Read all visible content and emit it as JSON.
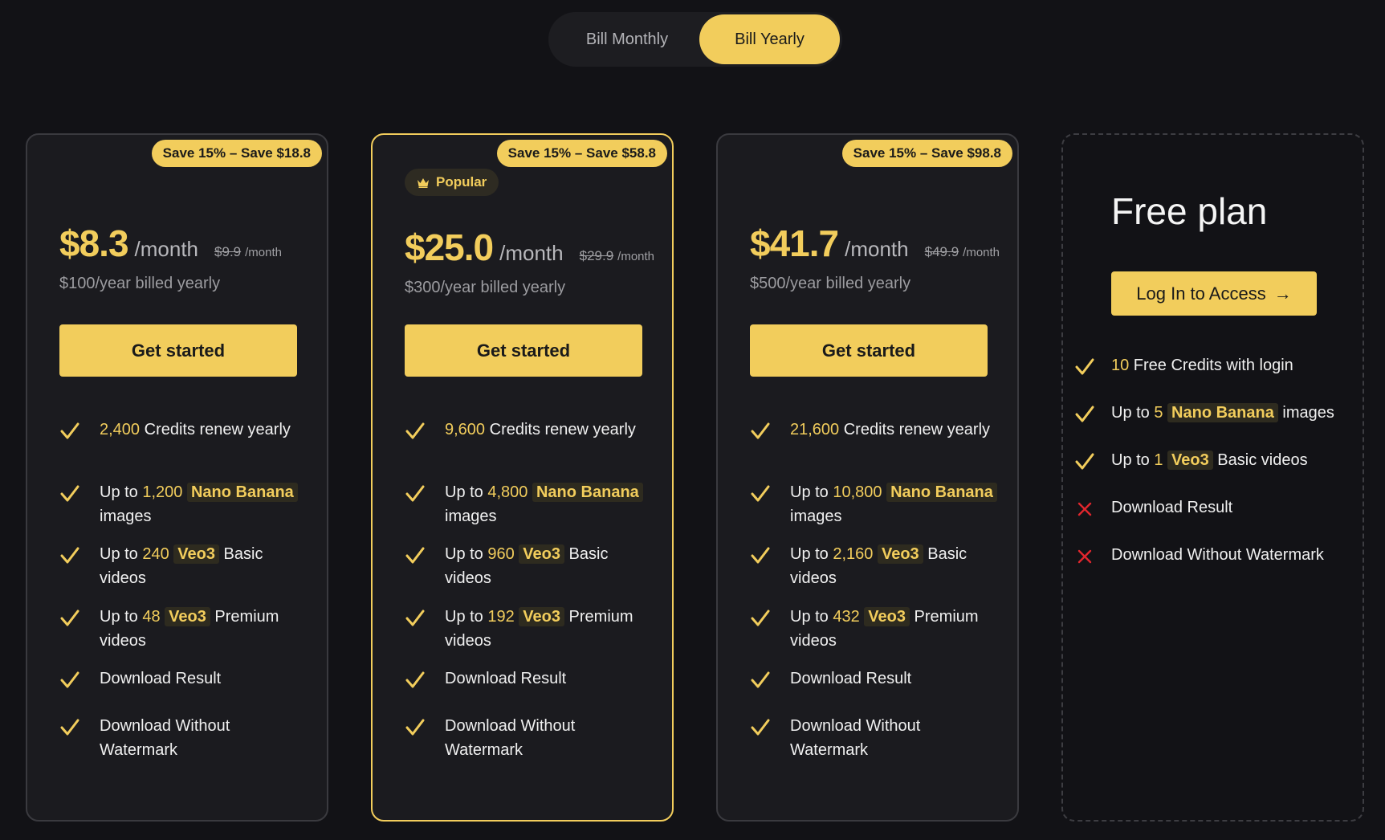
{
  "billing_toggle": {
    "monthly_label": "Bill Monthly",
    "yearly_label": "Bill Yearly",
    "selected": "yearly"
  },
  "colors": {
    "accent": "#f2cd5c",
    "background": "#121216",
    "card": "#1b1b1f",
    "cross": "#e0262d"
  },
  "plans": [
    {
      "save_badge": "Save 15% – Save $18.8",
      "price": "$8.3",
      "per": "/month",
      "old_price": "$9.9",
      "old_per": "/month",
      "billed": "$100/year billed yearly",
      "cta": "Get started",
      "features": [
        {
          "hl": "2,400",
          "text": " Credits renew yearly"
        },
        {
          "pre": "Up to ",
          "hl": "1,200",
          "tag": "Nano Banana",
          "text": " images"
        },
        {
          "pre": "Up to ",
          "hl": "240",
          "tag": "Veo3",
          "text": " Basic videos"
        },
        {
          "pre": "Up to ",
          "hl": "48",
          "tag": "Veo3",
          "text": " Premium videos"
        },
        {
          "text": "Download Result"
        },
        {
          "text": "Download Without Watermark"
        }
      ]
    },
    {
      "save_badge": "Save 15% – Save $58.8",
      "popular_badge": "Popular",
      "price": "$25.0",
      "per": "/month",
      "old_price": "$29.9",
      "old_per": "/month",
      "billed": "$300/year billed yearly",
      "cta": "Get started",
      "features": [
        {
          "hl": "9,600",
          "text": " Credits renew yearly"
        },
        {
          "pre": "Up to ",
          "hl": "4,800",
          "tag": "Nano Banana",
          "text": " images"
        },
        {
          "pre": "Up to ",
          "hl": "960",
          "tag": "Veo3",
          "text": " Basic videos"
        },
        {
          "pre": "Up to ",
          "hl": "192",
          "tag": "Veo3",
          "text": " Premium videos"
        },
        {
          "text": "Download Result"
        },
        {
          "text": "Download Without Watermark"
        }
      ]
    },
    {
      "save_badge": "Save 15% – Save $98.8",
      "price": "$41.7",
      "per": "/month",
      "old_price": "$49.9",
      "old_per": "/month",
      "billed": "$500/year billed yearly",
      "cta": "Get started",
      "features": [
        {
          "hl": "21,600",
          "text": " Credits renew yearly"
        },
        {
          "pre": "Up to ",
          "hl": "10,800",
          "tag": "Nano Banana",
          "text": " images"
        },
        {
          "pre": "Up to ",
          "hl": "2,160",
          "tag": "Veo3",
          "text": " Basic videos"
        },
        {
          "pre": "Up to ",
          "hl": "432",
          "tag": "Veo3",
          "text": " Premium videos"
        },
        {
          "text": "Download Result"
        },
        {
          "text": "Download Without Watermark"
        }
      ]
    }
  ],
  "free_plan": {
    "title": "Free plan",
    "cta": "Log In to Access",
    "cta_arrow": "→",
    "features": [
      {
        "hl": "10",
        "text": " Free Credits with login",
        "icon": "check"
      },
      {
        "pre": "Up to ",
        "hl": "5",
        "tag": "Nano Banana",
        "text": " images",
        "icon": "check"
      },
      {
        "pre": "Up to ",
        "hl": "1",
        "tag": "Veo3",
        "text": " Basic videos",
        "icon": "check"
      },
      {
        "text": "Download Result",
        "icon": "cross"
      },
      {
        "text": "Download Without Watermark",
        "icon": "cross"
      }
    ]
  }
}
